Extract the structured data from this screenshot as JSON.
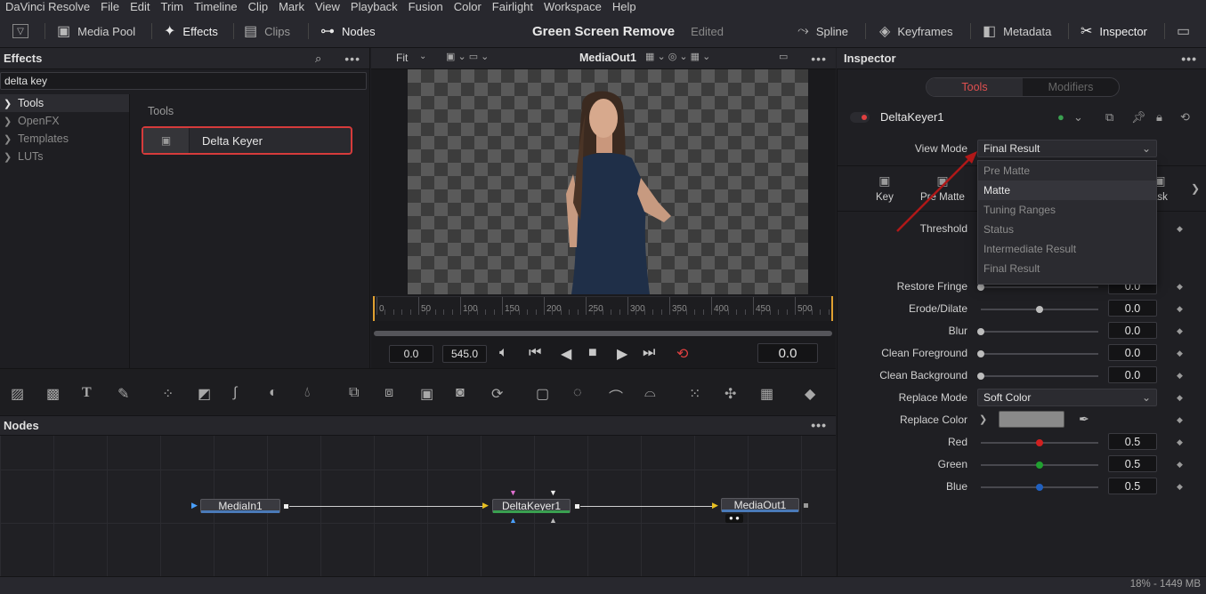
{
  "menu": [
    "DaVinci Resolve",
    "File",
    "Edit",
    "Trim",
    "Timeline",
    "Clip",
    "Mark",
    "View",
    "Playback",
    "Fusion",
    "Color",
    "Fairlight",
    "Workspace",
    "Help"
  ],
  "toolbar": {
    "media_pool": "Media Pool",
    "effects": "Effects",
    "clips": "Clips",
    "nodes": "Nodes",
    "project_title": "Green Screen Remove",
    "project_status": "Edited",
    "spline": "Spline",
    "keyframes": "Keyframes",
    "metadata": "Metadata",
    "inspector": "Inspector"
  },
  "effects_panel": {
    "title": "Effects",
    "search_value": "delta key",
    "tree": [
      {
        "label": "Tools",
        "selected": true
      },
      {
        "label": "OpenFX",
        "selected": false
      },
      {
        "label": "Templates",
        "selected": false
      },
      {
        "label": "LUTs",
        "selected": false
      }
    ],
    "category": "Tools",
    "result": "Delta Keyer"
  },
  "viewer": {
    "zoom": "Fit",
    "output_name": "MediaOut1",
    "ruler_ticks": [
      "0",
      "50",
      "100",
      "150",
      "200",
      "250",
      "300",
      "350",
      "400",
      "450",
      "500"
    ],
    "start_time": "0.0",
    "end_time": "545.0",
    "current_time": "0.0"
  },
  "nodes_panel": {
    "title": "Nodes",
    "nodes": [
      "MediaIn1",
      "DeltaKeyer1",
      "MediaOut1"
    ]
  },
  "inspector": {
    "title": "Inspector",
    "tab_tools": "Tools",
    "tab_modifiers": "Modifiers",
    "node_name": "DeltaKeyer1",
    "view_mode_label": "View Mode",
    "view_mode_value": "Final Result",
    "subtabs": [
      "Key",
      "Pre Matte",
      "ask"
    ],
    "dropdown_options": [
      "Pre Matte",
      "Matte",
      "Tuning Ranges",
      "Status",
      "Intermediate Result",
      "Final Result"
    ],
    "dropdown_highlight": "Matte",
    "threshold_label": "Threshold",
    "params": [
      {
        "label": "Restore Fringe",
        "value": "0.0",
        "pos": 0.0
      },
      {
        "label": "Erode/Dilate",
        "value": "0.0",
        "pos": 0.5
      },
      {
        "label": "Blur",
        "value": "0.0",
        "pos": 0.0
      },
      {
        "label": "Clean Foreground",
        "value": "0.0",
        "pos": 0.0
      },
      {
        "label": "Clean Background",
        "value": "0.0",
        "pos": 0.0
      }
    ],
    "replace_mode_label": "Replace Mode",
    "replace_mode_value": "Soft Color",
    "replace_color_label": "Replace Color",
    "replace_color_hex": "#8a8a8a",
    "color_params": [
      {
        "label": "Red",
        "value": "0.5",
        "pos": 0.5,
        "color": "#d02020"
      },
      {
        "label": "Green",
        "value": "0.5",
        "pos": 0.5,
        "color": "#20a030"
      },
      {
        "label": "Blue",
        "value": "0.5",
        "pos": 0.5,
        "color": "#2060c0"
      }
    ]
  },
  "status": {
    "memory": "18% - 1449 MB"
  },
  "colors": {
    "accent_red": "#d63b3b",
    "panel_bg": "#1f1f23"
  }
}
